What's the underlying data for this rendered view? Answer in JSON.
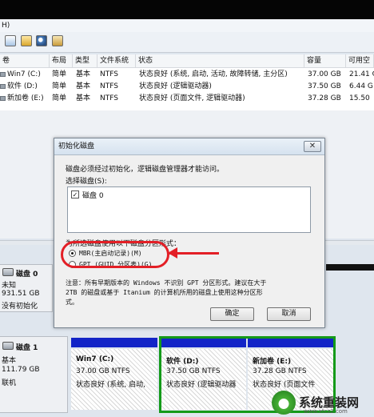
{
  "menubar": {
    "help_fragment": "H)"
  },
  "toolbar": {
    "icons": [
      "properties-icon",
      "folder-icon",
      "search-icon",
      "settings-icon"
    ]
  },
  "volume_table": {
    "columns": [
      "卷",
      "布局",
      "类型",
      "文件系统",
      "状态",
      "容量",
      "可用空"
    ],
    "rows": [
      {
        "name": "Win7 (C:)",
        "layout": "简单",
        "type": "基本",
        "fs": "NTFS",
        "status": "状态良好 (系统, 启动, 活动, 故障转储, 主分区)",
        "capacity": "37.00 GB",
        "free": "21.41 G"
      },
      {
        "name": "软件 (D:)",
        "layout": "简单",
        "type": "基本",
        "fs": "NTFS",
        "status": "状态良好 (逻辑驱动器)",
        "capacity": "37.50 GB",
        "free": "6.44 G"
      },
      {
        "name": "新加卷 (E:)",
        "layout": "简单",
        "type": "基本",
        "fs": "NTFS",
        "status": "状态良好 (页面文件, 逻辑驱动器)",
        "capacity": "37.28 GB",
        "free": "15.50"
      }
    ]
  },
  "dialog": {
    "title": "初始化磁盘",
    "close_glyph": "✕",
    "intro": "磁盘必须经过初始化，逻辑磁盘管理器才能访问。",
    "select_label": "选择磁盘(S):",
    "disk_item": "磁盘 0",
    "style_label": "为所选磁盘使用以下磁盘分区形式：",
    "option_mbr": "MBR(主启动记录)(M)",
    "option_gpt": "GPT (GUID 分区表)(G)",
    "note_line1": "注意：所有早期版本的 Windows 不识别 GPT 分区形式。建议在大于",
    "note_line2": "2TB 的磁盘或基于 Itanium 的计算机所用的磁盘上使用这种分区形",
    "note_line3": "式。",
    "ok_label": "确定",
    "cancel_label": "取消"
  },
  "disk0": {
    "name": "磁盘 0",
    "kind": "未知",
    "size": "931.51 GB",
    "status": "没有初始化"
  },
  "disk1": {
    "name": "磁盘 1",
    "kind": "基本",
    "size": "111.79 GB",
    "status": "联机"
  },
  "partitions": [
    {
      "name": "Win7 (C:)",
      "size": "37.00 GB NTFS",
      "status": "状态良好 (系统, 启动,"
    },
    {
      "name": "软件 (D:)",
      "size": "37.50 GB NTFS",
      "status": "状态良好 (逻辑驱动器"
    },
    {
      "name": "新加卷 (E:)",
      "size": "37.28 GB NTFS",
      "status": "状态良好 (页面文件"
    }
  ],
  "watermark": {
    "site_name": "系统重装网",
    "url": "www.xtcz2.com"
  },
  "colors": {
    "partition_bar": "#1224c7",
    "selection_border": "#149a19",
    "annotation": "#e31f26"
  }
}
